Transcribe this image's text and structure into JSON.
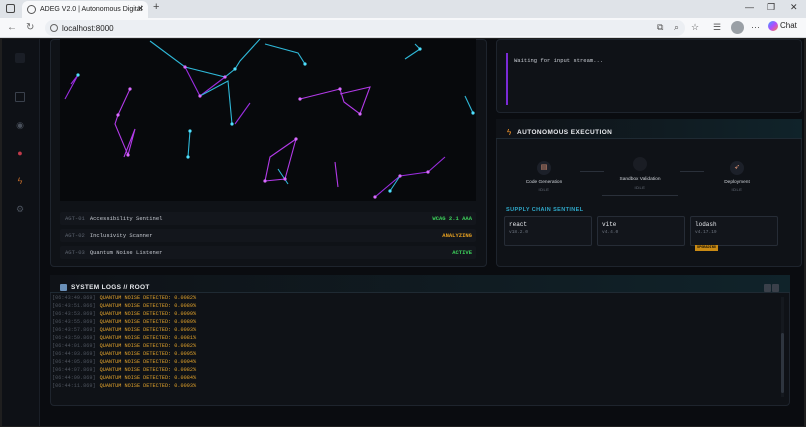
{
  "browser": {
    "tab_title": "ADEG V2.0 | Autonomous Digital",
    "url": "localhost:8000",
    "chat_label": "Chat"
  },
  "agents": [
    {
      "id": "AGT-01",
      "name": "Accessibility Sentinel",
      "status": "WCAG 2.1 AAA",
      "status_color": "#3ccf5a"
    },
    {
      "id": "AGT-02",
      "name": "Inclusivity Scanner",
      "status": "ANALYZING",
      "status_color": "#e6a020"
    },
    {
      "id": "AGT-03",
      "name": "Quantum Noise Listener",
      "status": "ACTIVE",
      "status_color": "#3ccf5a"
    }
  ],
  "input_stream": {
    "text": "Waiting for input stream..."
  },
  "execution": {
    "title": "AUTONOMOUS EXECUTION",
    "stages": [
      {
        "label": "Code Generation",
        "status": "IDLE",
        "icon": "file-code-icon"
      },
      {
        "label": "Sandbox Validation",
        "status": "IDLE",
        "icon": "sandbox-icon"
      },
      {
        "label": "Deployment",
        "status": "IDLE",
        "icon": "rocket-icon"
      }
    ]
  },
  "supply_chain": {
    "title": "SUPPLY CHAIN SENTINEL",
    "packages": [
      {
        "name": "react",
        "version": "v18.2.0",
        "warning": ""
      },
      {
        "name": "vite",
        "version": "v4.4.0",
        "warning": ""
      },
      {
        "name": "lodash",
        "version": "v4.17.19",
        "warning": "UPGRADING"
      }
    ]
  },
  "system_logs": {
    "title": "SYSTEM LOGS // ROOT",
    "lines": [
      {
        "time": "[06:43:49.869]",
        "msg": "QUANTUM NOISE DETECTED: 0.0082%"
      },
      {
        "time": "[06:43:51.866]",
        "msg": "QUANTUM NOISE DETECTED: 0.0089%"
      },
      {
        "time": "[06:43:53.869]",
        "msg": "QUANTUM NOISE DETECTED: 0.0099%"
      },
      {
        "time": "[06:43:55.869]",
        "msg": "QUANTUM NOISE DETECTED: 0.0089%"
      },
      {
        "time": "[06:43:57.869]",
        "msg": "QUANTUM NOISE DETECTED: 0.0093%"
      },
      {
        "time": "[06:43:59.869]",
        "msg": "QUANTUM NOISE DETECTED: 0.0081%"
      },
      {
        "time": "[06:44:01.869]",
        "msg": "QUANTUM NOISE DETECTED: 0.0082%"
      },
      {
        "time": "[06:44:03.869]",
        "msg": "QUANTUM NOISE DETECTED: 0.0095%"
      },
      {
        "time": "[06:44:05.869]",
        "msg": "QUANTUM NOISE DETECTED: 0.0094%"
      },
      {
        "time": "[06:44:07.869]",
        "msg": "QUANTUM NOISE DETECTED: 0.0082%"
      },
      {
        "time": "[06:44:09.869]",
        "msg": "QUANTUM NOISE DETECTED: 0.0084%"
      },
      {
        "time": "[06:44:11.869]",
        "msg": "QUANTUM NOISE DETECTED: 0.0093%"
      }
    ]
  }
}
